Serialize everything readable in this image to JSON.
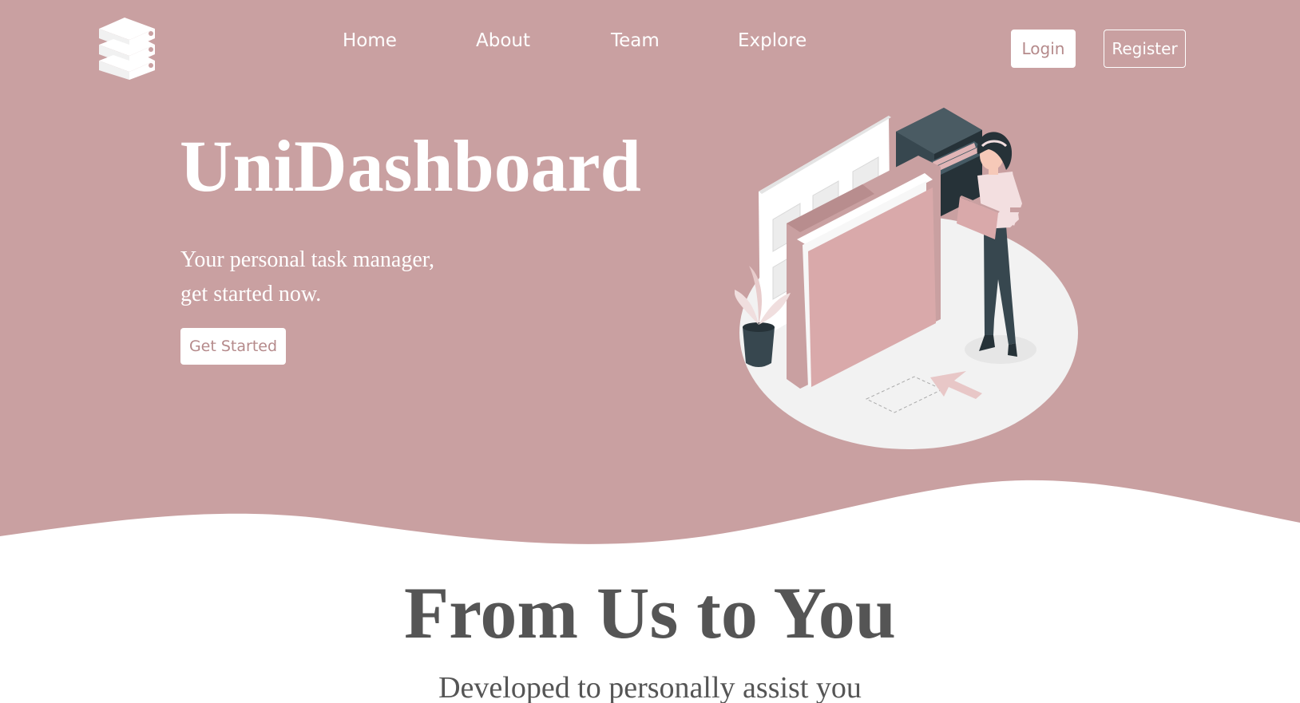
{
  "colors": {
    "hero_background": "#c9a0a1",
    "accent_text": "#b58a8b",
    "section_text": "#555555",
    "white": "#ffffff"
  },
  "header": {
    "logo_icon": "stacked-layers-icon",
    "nav": [
      {
        "label": "Home"
      },
      {
        "label": "About"
      },
      {
        "label": "Team"
      },
      {
        "label": "Explore"
      }
    ],
    "login_label": "Login",
    "register_label": "Register"
  },
  "hero": {
    "title": "UniDashboard",
    "subtitle_line1": "Your personal task manager,",
    "subtitle_line2": "get started now.",
    "cta_label": "Get Started",
    "illustration": "woman-with-folders-illustration"
  },
  "about": {
    "title": "From Us to You",
    "subtitle": "Developed to personally assist you"
  }
}
